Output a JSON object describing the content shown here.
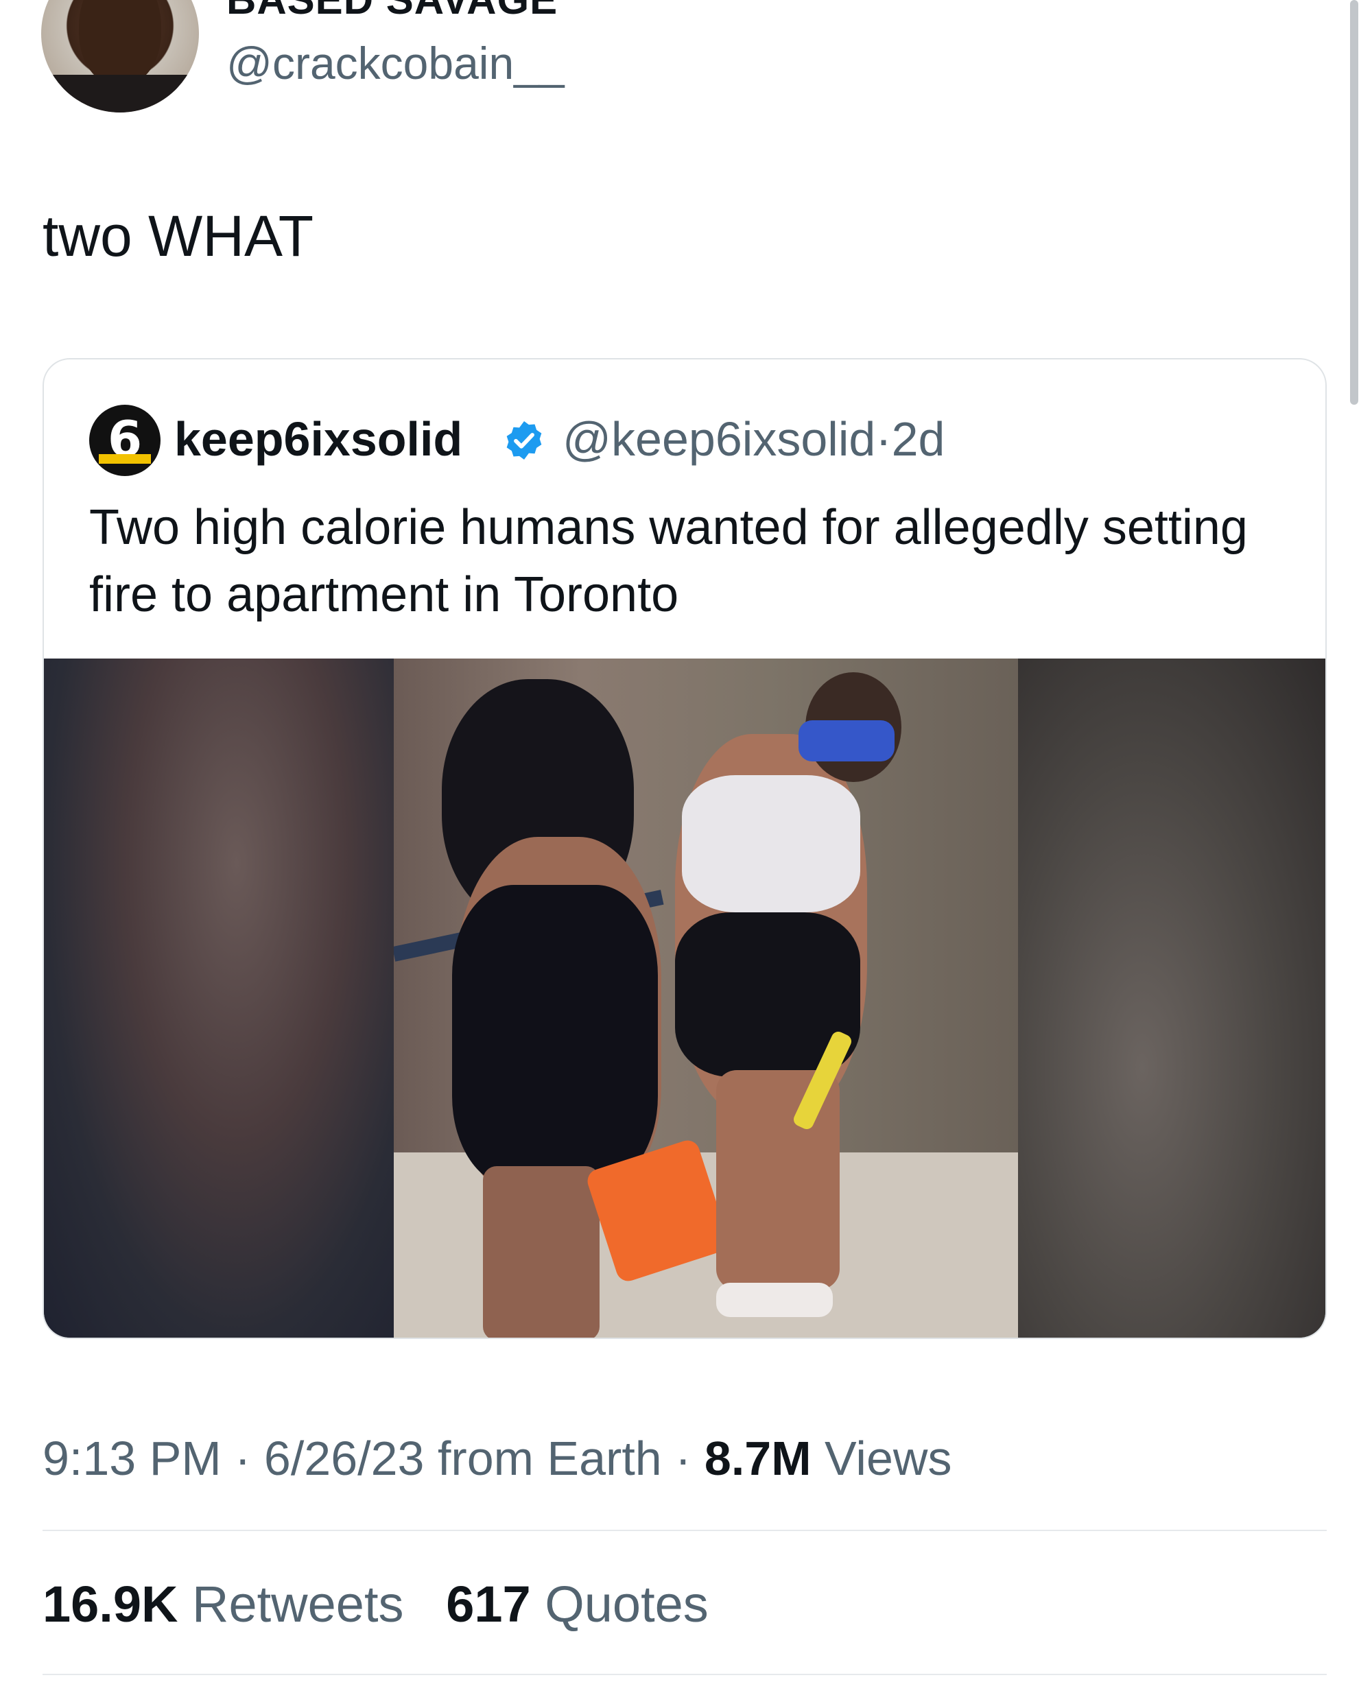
{
  "author": {
    "display_name": "BASED SAVAGE",
    "handle": "@crackcobain__"
  },
  "tweet": {
    "text": "two WHAT"
  },
  "quoted_tweet": {
    "name": "keep6ixsolid",
    "handle": "@keep6ixsolid",
    "separator": "·",
    "age": "2d",
    "text": "Two high calorie humans wanted for allegedly setting fire to apartment in Toronto",
    "verified_color": "#1d9bf0"
  },
  "meta": {
    "time": "9:13 PM",
    "sep1": "·",
    "date": "6/26/23",
    "source": "from Earth",
    "sep2": "·",
    "views_count": "8.7M",
    "views_label": "Views"
  },
  "stats": {
    "retweets_count": "16.9K",
    "retweets_label": "Retweets",
    "quotes_count": "617",
    "quotes_label": "Quotes"
  }
}
